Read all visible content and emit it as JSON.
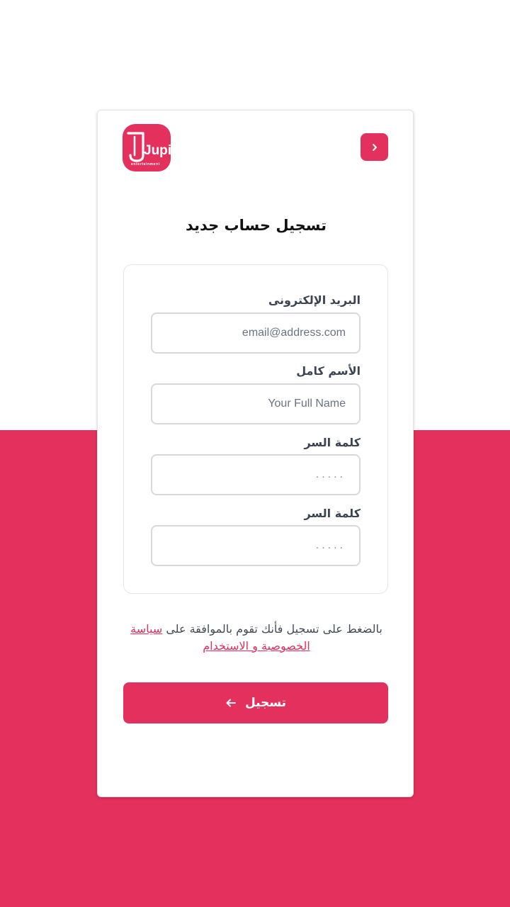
{
  "brand": {
    "logo_text": "Jupi",
    "logo_subtext": "entertainment",
    "color": "#e3305c"
  },
  "header": {
    "back_icon": "chevron-right-icon"
  },
  "page_title": "تسجيل حساب جديد",
  "form": {
    "email": {
      "label": "البريد الإلكترونى",
      "placeholder": "email@address.com",
      "value": ""
    },
    "full_name": {
      "label": "الأسم كامل",
      "placeholder": "Your Full Name",
      "value": ""
    },
    "password": {
      "label": "كلمة السر",
      "placeholder": ".....",
      "value": ""
    },
    "password_confirm": {
      "label": "كلمة السر",
      "placeholder": ".....",
      "value": ""
    }
  },
  "terms": {
    "text": "بالضغط على تسجيل فأنك تقوم بالموافقة على",
    "link_text": "سياسة الخصوصبة و الاستخدام"
  },
  "submit": {
    "label": "تسجيل",
    "icon": "arrow-left-icon"
  }
}
